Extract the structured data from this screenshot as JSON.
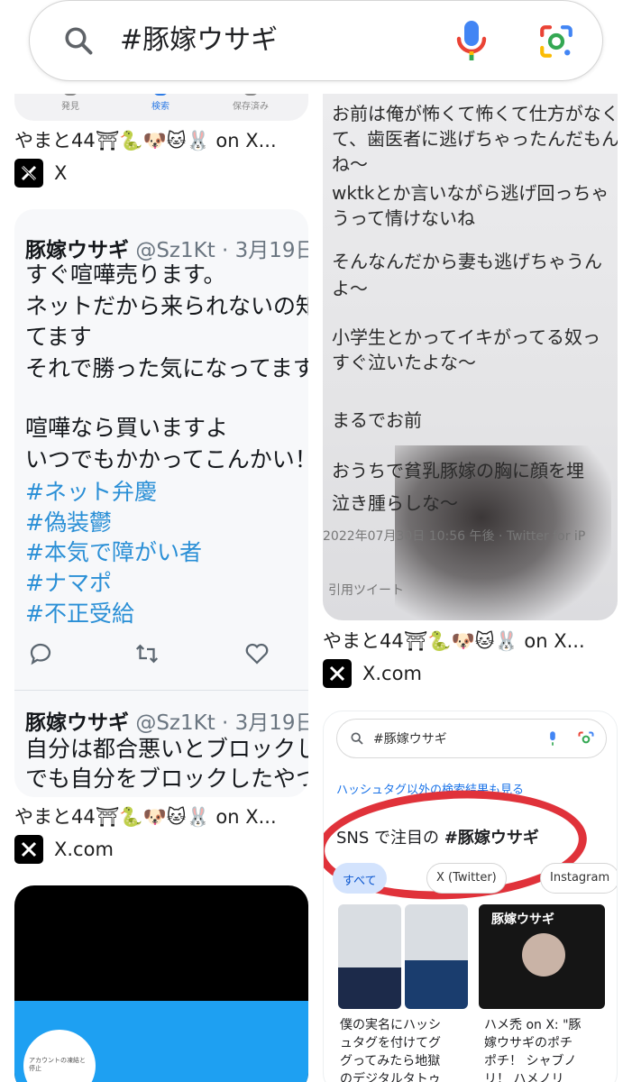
{
  "search": {
    "query": "#豚嫁ウサギ"
  },
  "colors": {
    "hashtag": "#2a8fd6",
    "red_circle": "#e0323a",
    "link_blue": "#1a73e8"
  },
  "results": {
    "left": [
      {
        "tabs": [
          "発見",
          "検索",
          "保存済み"
        ],
        "caption": "やまと44⛩🐍🐶🐱🐰 on X...",
        "source": "X"
      },
      {
        "caption": "やまと44⛩🐍🐶🐱🐰 on X...",
        "source": "X.com",
        "tweet": {
          "name": "豚嫁ウサギ",
          "handle": "@Sz1Kt · 3月19日",
          "lines": [
            "すぐ喧嘩売ります。",
            "ネットだから来られないの知",
            "てます",
            "それで勝った気になってます",
            "",
            "喧嘩なら買いますよ",
            "いつでもかかってこんかい！"
          ],
          "tags": [
            "#ネット弁慶",
            "#偽装鬱",
            "#本気で障がい者",
            "#ナマポ",
            "#不正受給"
          ],
          "second_name": "豚嫁ウサギ",
          "second_handle": "@Sz1Kt · 3月19日",
          "second_lines": [
            "自分は都合悪いとブロックし",
            "でも自分をブロックしたやつ"
          ]
        }
      },
      {
        "bubble_text": "アカウントの凍結と停止"
      }
    ],
    "right": [
      {
        "caption": "やまと44⛩🐍🐶🐱🐰 on X...",
        "source": "X.com",
        "lines": [
          "お前は俺が怖くて怖くて仕方がなく",
          "て、歯医者に逃げちゃったんだもん",
          "ね〜",
          "wktkとか言いながら逃げ回っちゃ",
          "うって情けないね",
          "そんなんだから妻も逃げちゃうん",
          "よ〜",
          "小学生とかってイキがってる奴っ",
          "すぐ泣いたよな〜",
          "まるでお前",
          "おうちで貧乳豚嫁の胸に顔を埋",
          "泣き腫らしな〜"
        ],
        "meta": "2022年07月30日 10:56 午後 · Twitter for iP",
        "retweet": "引用ツイート"
      },
      {
        "mini_search": "#豚嫁ウサギ",
        "link": "ハッシュタグ以外の検索結果も見る",
        "section_prefix": "SNS で注目の ",
        "section_tag": "#豚嫁ウサギ",
        "chips": [
          "すべて",
          "X (Twitter)",
          "Instagram"
        ],
        "shirt_text": "豚嫁ウサギ",
        "result_left": [
          "僕の実名にハッシ",
          "ュタグを付けてグ",
          "グってみたら地獄",
          "のデジタルタトゥ"
        ],
        "result_right": [
          "ハメ禿 on X: \"豚",
          "嫁ウサギのポチ",
          "ポチ！ シャブノ",
          "リ！ ハメノリ"
        ]
      }
    ]
  }
}
